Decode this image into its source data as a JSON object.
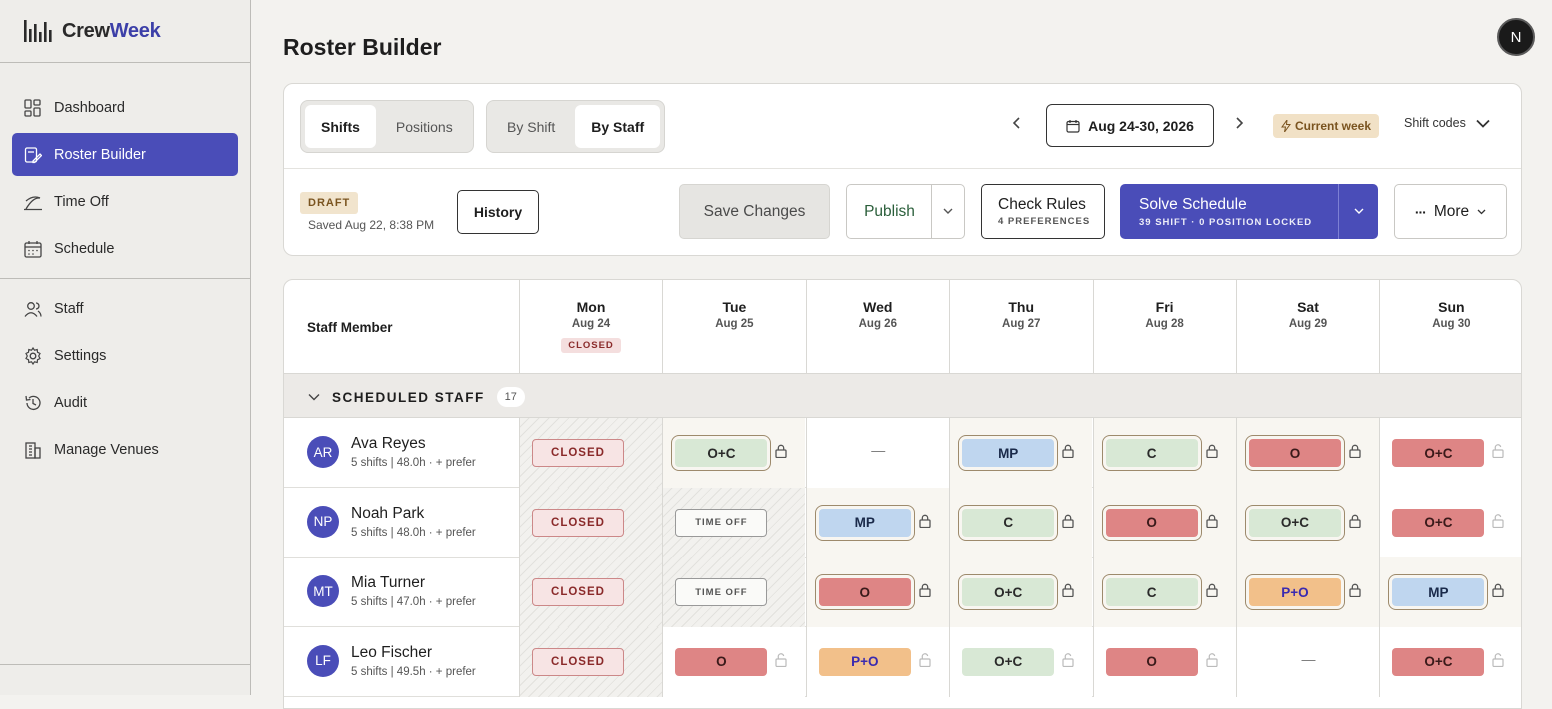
{
  "app": {
    "name_part1": "Crew",
    "name_part2": "Week"
  },
  "sidebar": {
    "items": [
      {
        "label": "Dashboard",
        "icon": "dashboard-icon"
      },
      {
        "label": "Roster Builder",
        "icon": "roster-icon"
      },
      {
        "label": "Time Off",
        "icon": "time-off-icon"
      },
      {
        "label": "Schedule",
        "icon": "calendar-icon"
      },
      {
        "label": "Staff",
        "icon": "users-icon"
      },
      {
        "label": "Settings",
        "icon": "gear-icon"
      },
      {
        "label": "Audit",
        "icon": "history-icon"
      },
      {
        "label": "Manage Venues",
        "icon": "building-icon"
      }
    ],
    "active": "Roster Builder"
  },
  "header": {
    "title": "Roster Builder",
    "user_initial": "N"
  },
  "toolbar": {
    "view_tabs": [
      "Shifts",
      "Positions"
    ],
    "view_active": "Shifts",
    "group_tabs": [
      "By Shift",
      "By Staff"
    ],
    "group_active": "By Staff",
    "date_range": "Aug 24-30, 2026",
    "current_week": "Current week",
    "shift_codes": "Shift codes",
    "draft": "DRAFT",
    "saved": "Saved Aug 22, 8:38 PM",
    "history": "History",
    "save_changes": "Save Changes",
    "publish": "Publish",
    "check_rules": "Check Rules",
    "check_rules_sub": "4 PREFERENCES",
    "solve": "Solve Schedule",
    "solve_sub": "39 SHIFT · 0 POSITION LOCKED",
    "more": "More"
  },
  "grid": {
    "staff_header": "Staff Member",
    "days": [
      {
        "name": "Mon",
        "date": "Aug 24",
        "badge": "CLOSED"
      },
      {
        "name": "Tue",
        "date": "Aug 25",
        "badge": ""
      },
      {
        "name": "Wed",
        "date": "Aug 26",
        "badge": ""
      },
      {
        "name": "Thu",
        "date": "Aug 27",
        "badge": ""
      },
      {
        "name": "Fri",
        "date": "Aug 28",
        "badge": ""
      },
      {
        "name": "Sat",
        "date": "Aug 29",
        "badge": ""
      },
      {
        "name": "Sun",
        "date": "Aug 30",
        "badge": ""
      }
    ],
    "group": {
      "label": "SCHEDULED STAFF",
      "count": "17"
    },
    "closed_label": "CLOSED",
    "time_off_label": "TIME OFF",
    "empty": "—",
    "staff": [
      {
        "initials": "AR",
        "name": "Ava Reyes",
        "sub": "5 shifts | 48.0h ·  + prefer",
        "cells": [
          {
            "kind": "closed"
          },
          {
            "kind": "chip",
            "code": "O+C",
            "style": "oc",
            "locked": true
          },
          {
            "kind": "empty"
          },
          {
            "kind": "chip",
            "code": "MP",
            "style": "mp",
            "locked": true
          },
          {
            "kind": "chip",
            "code": "C",
            "style": "oc",
            "locked": true
          },
          {
            "kind": "chip",
            "code": "O",
            "style": "o",
            "locked": true
          },
          {
            "kind": "chip",
            "code": "O+C",
            "style": "o",
            "locked": false
          }
        ]
      },
      {
        "initials": "NP",
        "name": "Noah Park",
        "sub": "5 shifts | 48.0h ·  + prefer",
        "cells": [
          {
            "kind": "closed"
          },
          {
            "kind": "timeoff"
          },
          {
            "kind": "chip",
            "code": "MP",
            "style": "mp",
            "locked": true
          },
          {
            "kind": "chip",
            "code": "C",
            "style": "oc",
            "locked": true
          },
          {
            "kind": "chip",
            "code": "O",
            "style": "o",
            "locked": true
          },
          {
            "kind": "chip",
            "code": "O+C",
            "style": "oc",
            "locked": true
          },
          {
            "kind": "chip",
            "code": "O+C",
            "style": "o",
            "locked": false
          }
        ]
      },
      {
        "initials": "MT",
        "name": "Mia Turner",
        "sub": "5 shifts | 47.0h ·  + prefer",
        "cells": [
          {
            "kind": "closed"
          },
          {
            "kind": "timeoff"
          },
          {
            "kind": "chip",
            "code": "O",
            "style": "o",
            "locked": true
          },
          {
            "kind": "chip",
            "code": "O+C",
            "style": "oc",
            "locked": true
          },
          {
            "kind": "chip",
            "code": "C",
            "style": "oc",
            "locked": true
          },
          {
            "kind": "chip",
            "code": "P+O",
            "style": "po",
            "locked": true
          },
          {
            "kind": "chip",
            "code": "MP",
            "style": "mp",
            "locked": true
          }
        ]
      },
      {
        "initials": "LF",
        "name": "Leo Fischer",
        "sub": "5 shifts | 49.5h ·  + prefer",
        "cells": [
          {
            "kind": "closed"
          },
          {
            "kind": "chip",
            "code": "O",
            "style": "o",
            "locked": false
          },
          {
            "kind": "chip",
            "code": "P+O",
            "style": "po",
            "locked": false
          },
          {
            "kind": "chip",
            "code": "O+C",
            "style": "oc",
            "locked": false
          },
          {
            "kind": "chip",
            "code": "O",
            "style": "o",
            "locked": false
          },
          {
            "kind": "empty"
          },
          {
            "kind": "chip",
            "code": "O+C",
            "style": "o",
            "locked": false
          }
        ]
      }
    ]
  }
}
